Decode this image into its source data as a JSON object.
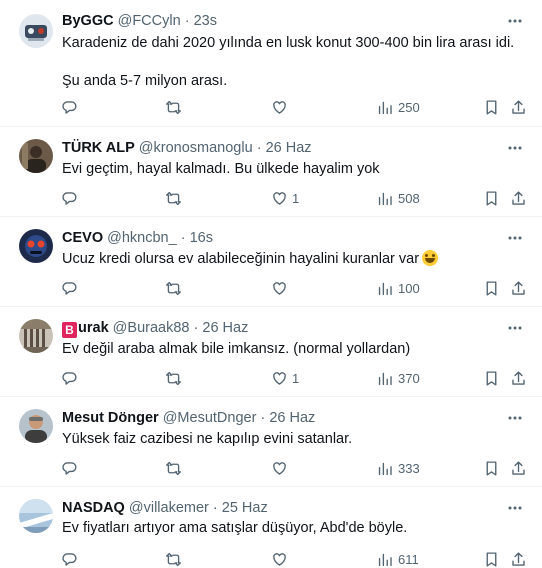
{
  "tweets": [
    {
      "name": "ByGGC",
      "handle": "@FCCyln",
      "dot": "·",
      "time": "23s",
      "text": "Karadeniz de dahi 2020 yılında en lusk konut 300-400 bin lira arası idi.\n\nŞu anda 5-7 milyon arası.",
      "likes": "",
      "views": "250"
    },
    {
      "name": "TÜRK ALP",
      "handle": "@kronosmanoglu",
      "dot": "·",
      "time": "26 Haz",
      "text": "Evi geçtim, hayal kalmadı. Bu ülkede hayalim yok",
      "likes": "1",
      "views": "508"
    },
    {
      "name": "CEVO",
      "handle": "@hkncbn_",
      "dot": "·",
      "time": "16s",
      "text": "Ucuz kredi olursa ev alabileceğinin hayalini kuranlar var",
      "emoji": "grinning-face-emoji",
      "likes": "",
      "views": "100"
    },
    {
      "name_badge": "B",
      "name": "urak",
      "handle": "@Buraak88",
      "dot": "·",
      "time": "26 Haz",
      "text": "Ev değil araba almak bile imkansız. (normal yollardan)",
      "likes": "1",
      "views": "370"
    },
    {
      "name": "Mesut Dönger",
      "handle": "@MesutDnger",
      "dot": "·",
      "time": "26 Haz",
      "text": "Yüksek faiz cazibesi ne kapılıp evini satanlar.",
      "likes": "",
      "views": "333"
    },
    {
      "name": "NASDAQ",
      "handle": "@villakemer",
      "dot": "·",
      "time": "25 Haz",
      "text": "Ev fiyatları artıyor ama satışlar düşüyor, Abd'de böyle.",
      "likes": "",
      "views": "611"
    }
  ],
  "icons": {
    "reply": "reply-icon",
    "retweet": "retweet-icon",
    "like": "heart-icon",
    "views": "views-icon",
    "bookmark": "bookmark-icon",
    "share": "share-icon",
    "more": "more-icon"
  },
  "colors": {
    "text": "#0f1419",
    "secondary": "#536471",
    "divider": "#eff3f4",
    "badge": "#e0245e"
  }
}
